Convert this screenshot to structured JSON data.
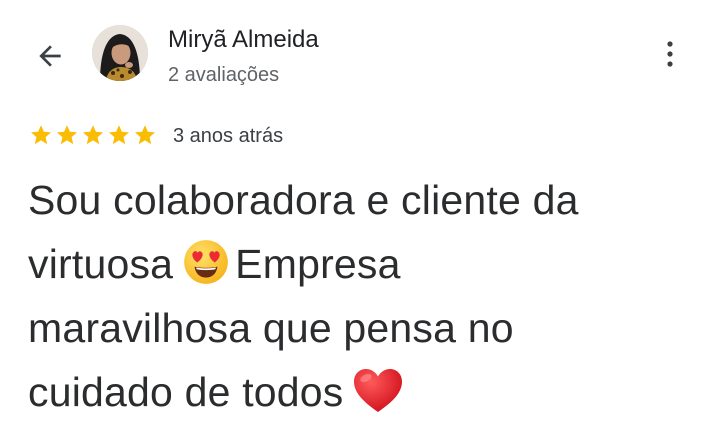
{
  "header": {
    "back_icon": "arrow-back-icon",
    "more_icon": "more-vert-icon"
  },
  "reviewer": {
    "name": "Miryã Almeida",
    "review_count": "2 avaliações"
  },
  "review": {
    "rating": 5,
    "rating_max": 5,
    "star_color": "#fbbc04",
    "time": "3 anos atrás",
    "line1": "Sou colaboradora e cliente da",
    "line2_before": "virtuosa",
    "line2_after": "Empresa",
    "line3": "maravilhosa que pensa no",
    "line4": "cuidado de todos",
    "emoji_1": "smiling-face-with-heart-eyes-icon",
    "emoji_2": "red-heart-icon"
  }
}
